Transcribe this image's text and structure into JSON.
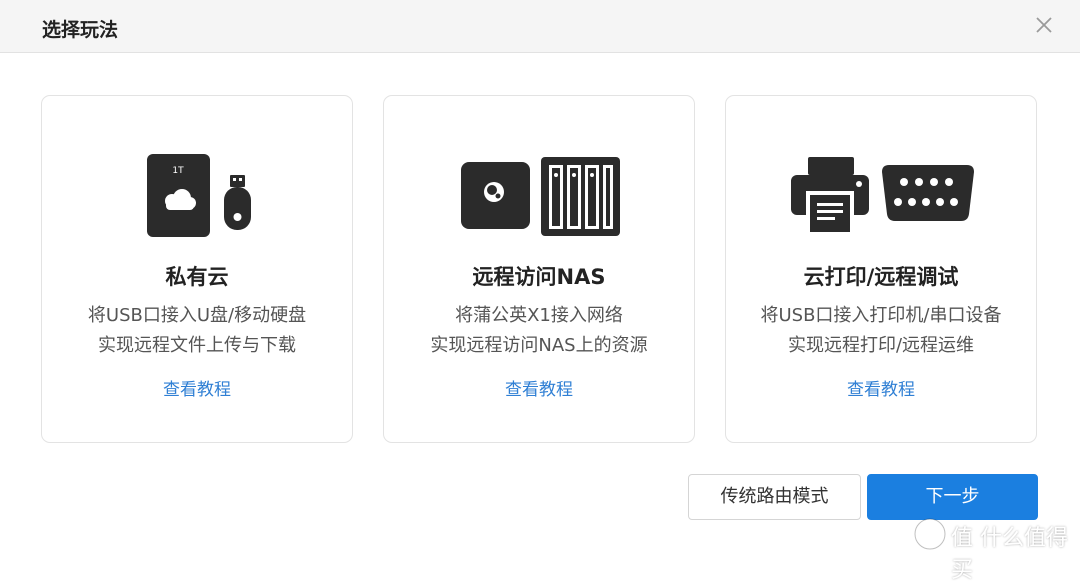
{
  "dialog": {
    "title": "选择玩法",
    "close_icon": "close-icon"
  },
  "cards": [
    {
      "title": "私有云",
      "desc_line1": "将USB口接入U盘/移动硬盘",
      "desc_line2": "实现远程文件上传与下载",
      "link": "查看教程",
      "icons": [
        "hard-drive-cloud-icon",
        "usb-stick-icon"
      ],
      "drive_label": "1T"
    },
    {
      "title": "远程访问NAS",
      "desc_line1": "将蒲公英X1接入网络",
      "desc_line2": "实现远程访问NAS上的资源",
      "link": "查看教程",
      "icons": [
        "router-device-icon",
        "nas-icon"
      ]
    },
    {
      "title": "云打印/远程调试",
      "desc_line1": "将USB口接入打印机/串口设备",
      "desc_line2": "实现远程打印/远程运维",
      "link": "查看教程",
      "icons": [
        "printer-icon",
        "serial-port-icon"
      ]
    }
  ],
  "footer": {
    "traditional_mode_label": "传统路由模式",
    "next_label": "下一步"
  },
  "watermark": {
    "text": "值 什么值得买",
    "icon": "smzdm-logo-icon"
  },
  "colors": {
    "primary": "#1b7fe0",
    "link": "#2f7fd4",
    "icon_dark": "#2b2b2b"
  }
}
